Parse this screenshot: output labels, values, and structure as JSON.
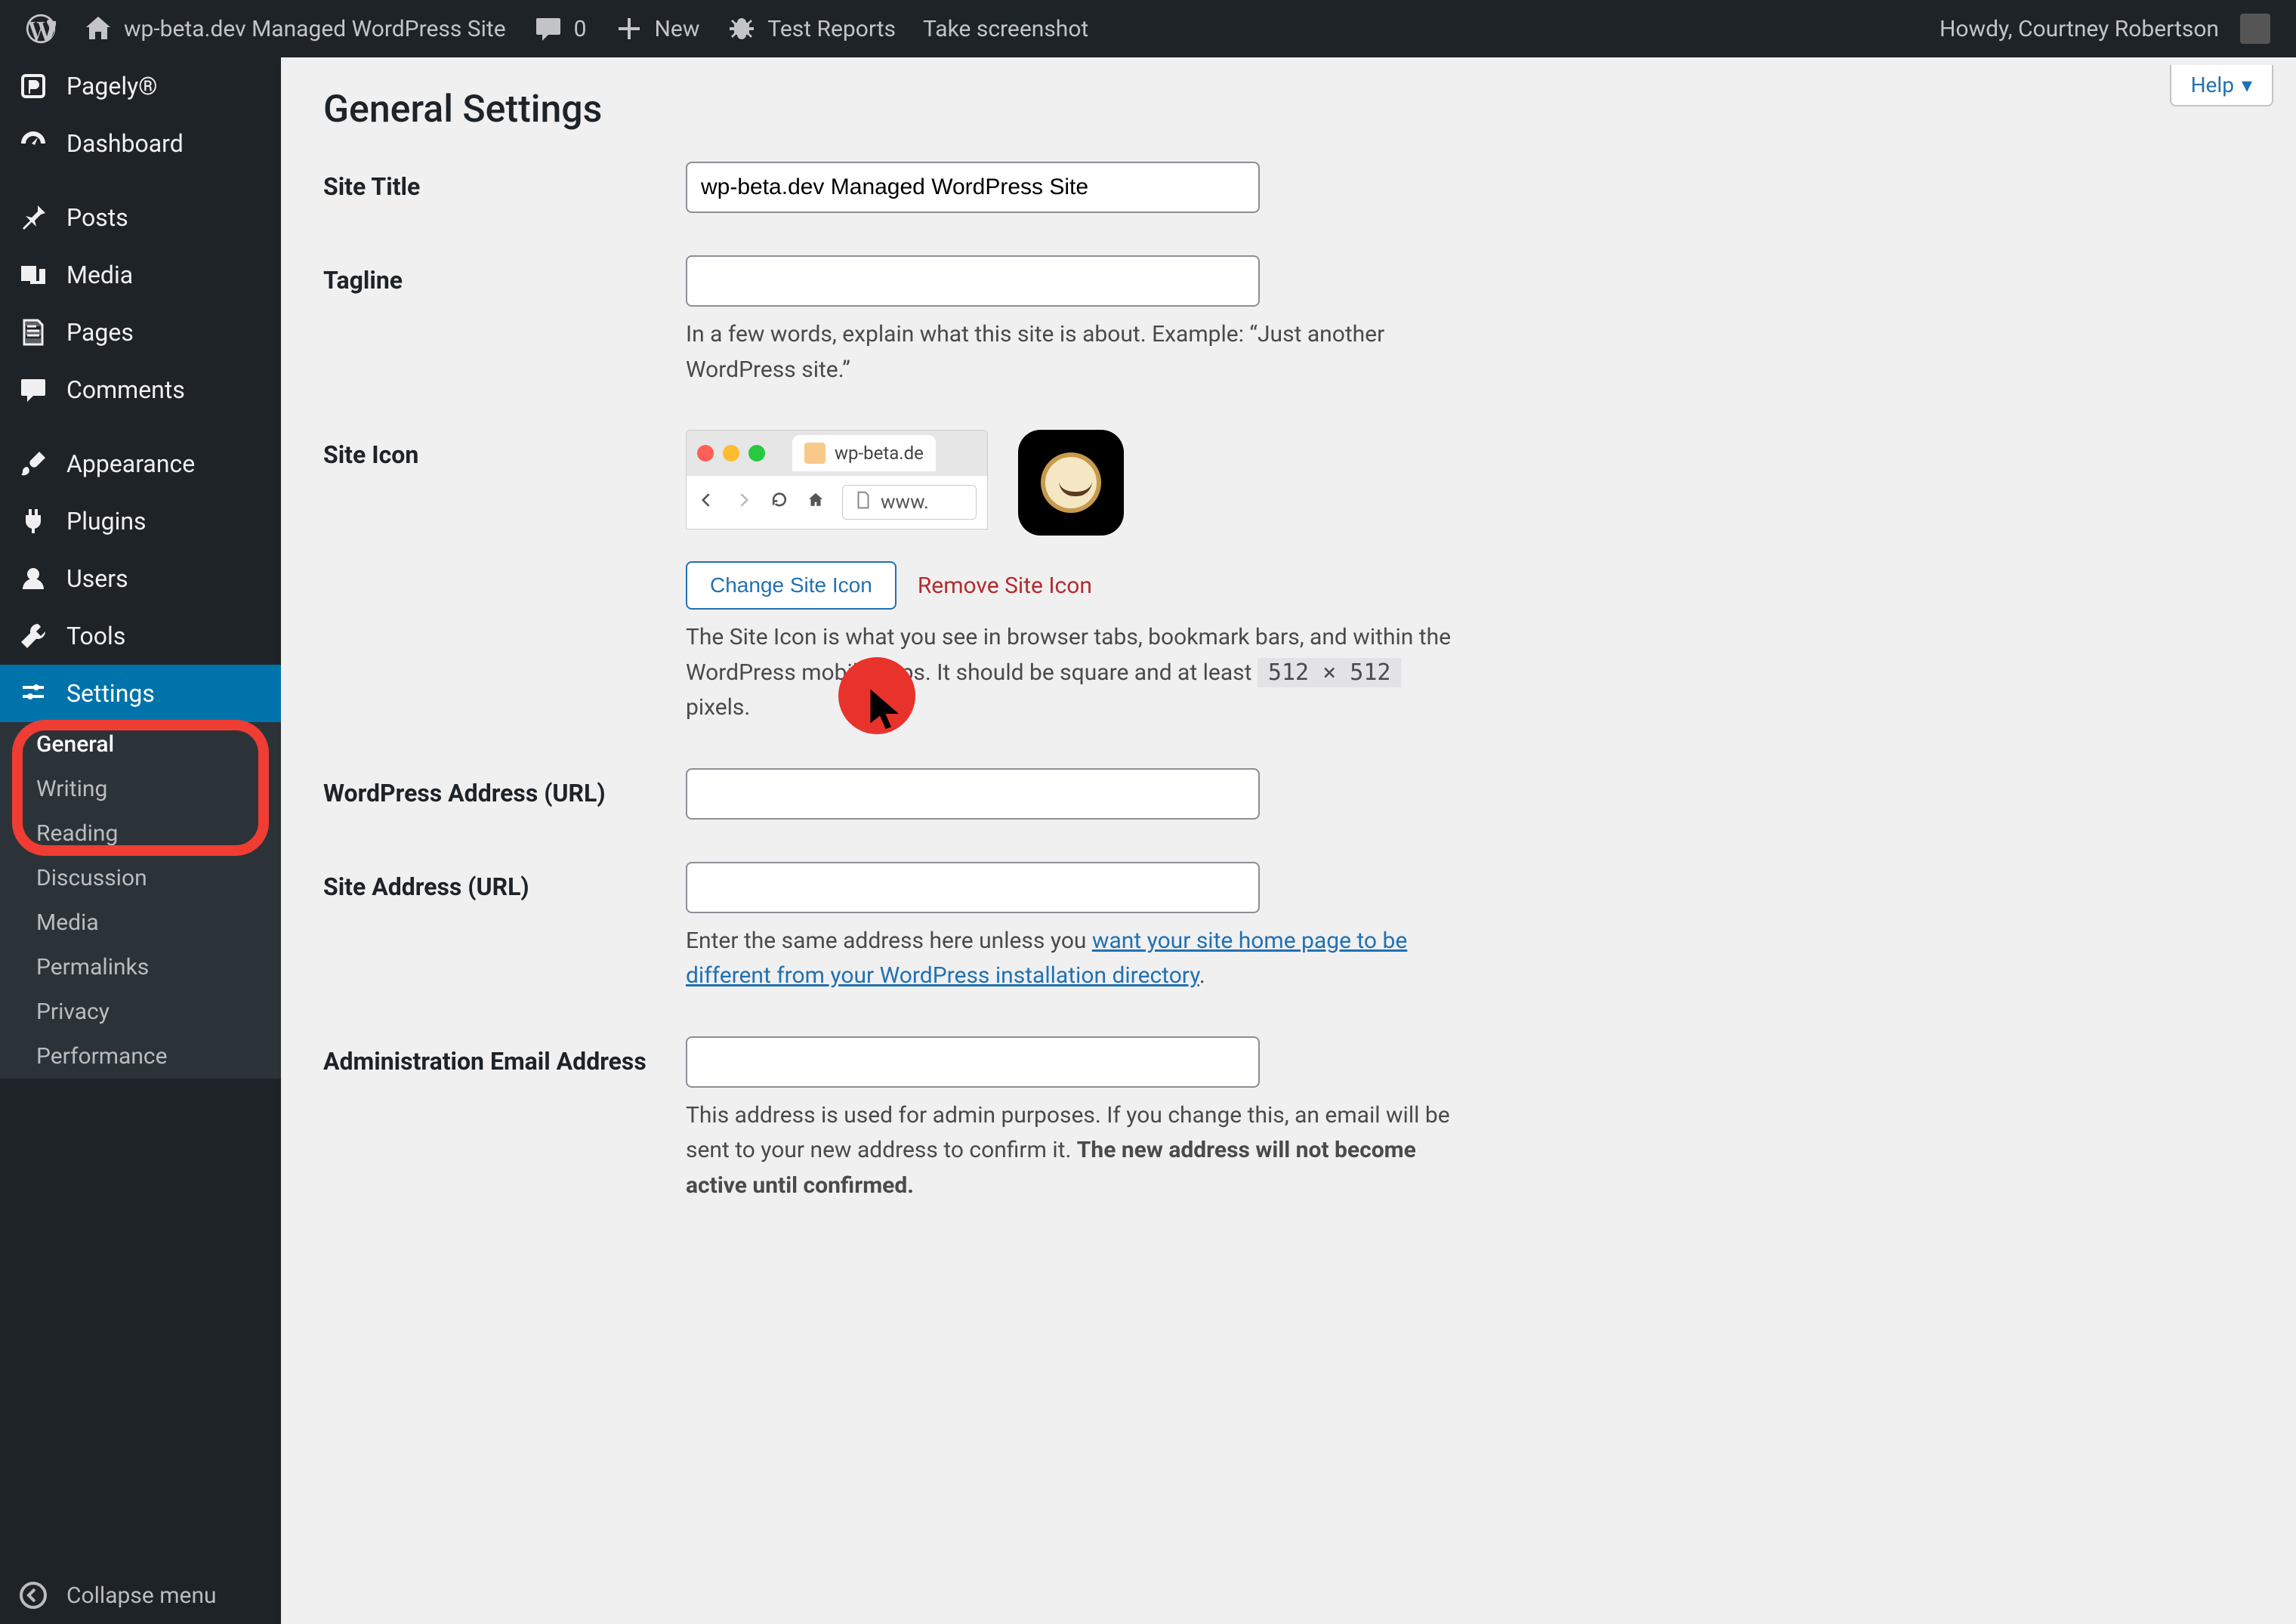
{
  "adminbar": {
    "site_name": "wp-beta.dev Managed WordPress Site",
    "comments_count": "0",
    "new_label": "New",
    "test_reports": "Test Reports",
    "screenshot": "Take screenshot",
    "howdy": "Howdy, Courtney Robertson"
  },
  "help": {
    "label": "Help"
  },
  "menu": {
    "pagely": "Pagely®",
    "dashboard": "Dashboard",
    "posts": "Posts",
    "media": "Media",
    "pages": "Pages",
    "comments": "Comments",
    "appearance": "Appearance",
    "plugins": "Plugins",
    "users": "Users",
    "tools": "Tools",
    "settings": "Settings",
    "collapse": "Collapse menu"
  },
  "submenu": {
    "general": "General",
    "writing": "Writing",
    "reading": "Reading",
    "discussion": "Discussion",
    "media": "Media",
    "permalinks": "Permalinks",
    "privacy": "Privacy",
    "performance": "Performance"
  },
  "page": {
    "title": "General Settings"
  },
  "fields": {
    "site_title": {
      "label": "Site Title",
      "value": "wp-beta.dev Managed WordPress Site"
    },
    "tagline": {
      "label": "Tagline",
      "value": "",
      "help": "In a few words, explain what this site is about. Example: “Just another WordPress site.”"
    },
    "site_icon": {
      "label": "Site Icon",
      "tab_text": "wp-beta.de",
      "url_text": "www.",
      "change_btn": "Change Site Icon",
      "remove_link": "Remove Site Icon",
      "help_a": "The Site Icon is what you see in browser tabs, bookmark bars, and within the WordPress mobile apps. It should be square and at least ",
      "help_dim": "512 × 512",
      "help_b": " pixels."
    },
    "wp_url": {
      "label": "WordPress Address (URL)",
      "value": ""
    },
    "site_url": {
      "label": "Site Address (URL)",
      "value": "",
      "help_a": "Enter the same address here unless you ",
      "help_link": "want your site home page to be different from your WordPress installation directory",
      "help_b": "."
    },
    "admin_email": {
      "label": "Administration Email Address",
      "value": "",
      "help_a": "This address is used for admin purposes. If you change this, an email will be sent to your new address to confirm it. ",
      "help_strong": "The new address will not become active until confirmed."
    }
  }
}
